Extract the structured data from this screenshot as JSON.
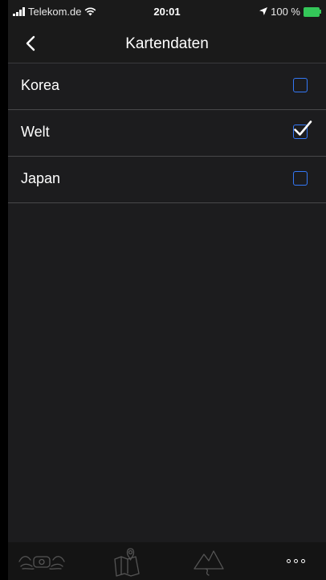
{
  "status_bar": {
    "carrier": "Telekom.de",
    "time": "20:01",
    "battery": "100 %"
  },
  "nav": {
    "title": "Kartendaten"
  },
  "list": {
    "items": [
      {
        "label": "Korea",
        "checked": false
      },
      {
        "label": "Welt",
        "checked": true
      },
      {
        "label": "Japan",
        "checked": false
      }
    ]
  },
  "tab_bar": {
    "tabs": [
      {
        "icon": "motorcycle-icon"
      },
      {
        "icon": "map-pin-icon"
      },
      {
        "icon": "mountain-route-icon"
      },
      {
        "icon": "more-icon"
      }
    ]
  },
  "colors": {
    "accent": "#3478f6",
    "battery": "#34c759",
    "background": "#1c1c1e"
  }
}
